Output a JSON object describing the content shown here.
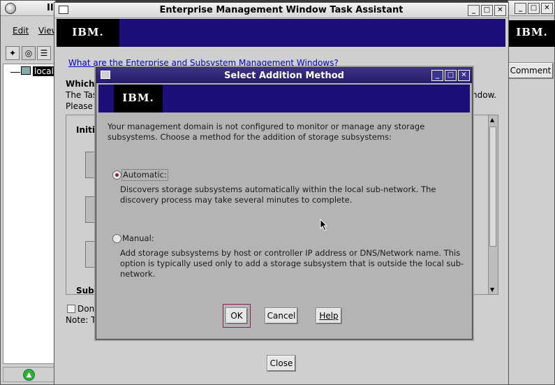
{
  "bg_window": {
    "title_fragment": "II",
    "menu": {
      "edit": "Edit",
      "view": "View"
    },
    "tree_item": "localh"
  },
  "right_window": {
    "ibm_logo": "IBM.",
    "comment_button": "Comment"
  },
  "task_window": {
    "title": "Enterprise Management Window Task Assistant",
    "ibm_logo": "IBM.",
    "help_link": "What are the Enterprise and Subsystem Management Windows?",
    "heading_partial": "Which T",
    "line1_partial": "The Tas",
    "line1_end": "ndow.",
    "line2_partial": "Please c",
    "group_initial": "Initia",
    "group_subsys": "Subs",
    "dont_show": "Don'",
    "note": "Note: T",
    "close_button": "Close"
  },
  "dialog": {
    "title": "Select Addition Method",
    "ibm_logo": "IBM.",
    "intro": "Your management domain is not configured to monitor or manage any storage subsystems. Choose a method for the addition of storage subsystems:",
    "automatic_label": "Automatic:",
    "automatic_desc": "Discovers storage subsystems automatically within the local sub-network. The discovery process may take several minutes to complete.",
    "manual_label": "Manual:",
    "manual_desc": "Add storage subsystems by host or controller IP address or DNS/Network name. This option is typically used only to add a storage subsystem that is outside the local sub-network.",
    "ok": "OK",
    "cancel": "Cancel",
    "help": "Help",
    "selected": "automatic"
  },
  "colors": {
    "ibm_banner": "#1c0f7a",
    "window_bg": "#cfcfcf",
    "link": "#0000cc",
    "radio_dot": "#8a1d57"
  }
}
